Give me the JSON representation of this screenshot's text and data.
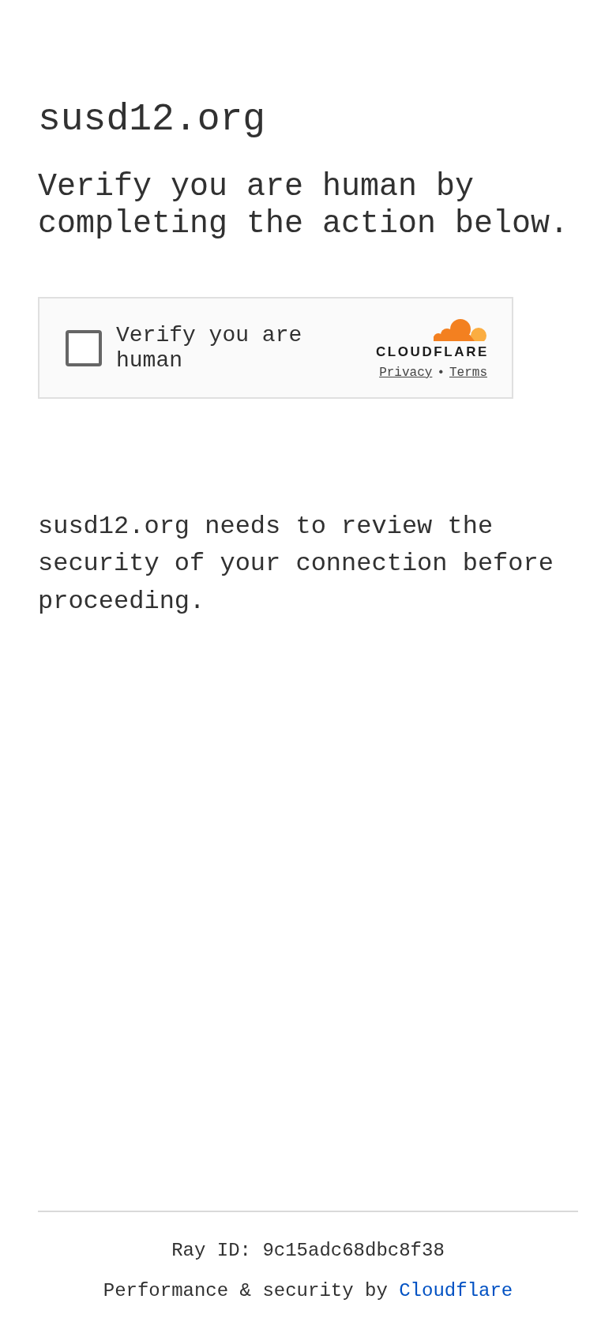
{
  "page": {
    "title": "susd12.org",
    "heading": "Verify you are human by completing the action below."
  },
  "widget": {
    "checkbox": {
      "label": "Verify you are human",
      "checked": false
    },
    "logo_text": "CLOUDFLARE",
    "links": [
      {
        "label": "Privacy"
      },
      {
        "label": "Terms"
      }
    ],
    "link_separator": "•"
  },
  "message": "susd12.org needs to review the security of your connection before proceeding.",
  "footer": {
    "ray_id": "Ray ID: 9c15adc68dbc8f38",
    "credit": "Performance & security by",
    "credit_link": "Cloudflare"
  }
}
